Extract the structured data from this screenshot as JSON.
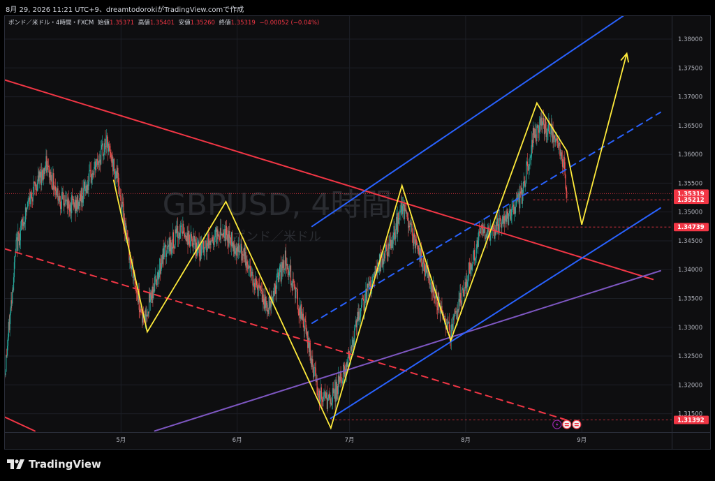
{
  "header": {
    "title": "8月 29, 2026 11:21 UTC+9、dreamtodorokiがTradingView.comで作成"
  },
  "legend": {
    "symbol": "ポンド／米ドル・4時間・FXCM",
    "open_label": "始値",
    "open": "1.35371",
    "high_label": "高値",
    "high": "1.35401",
    "low_label": "安値",
    "low": "1.35260",
    "close_label": "終値",
    "close": "1.35319",
    "change": "−0.00052 (−0.04%)"
  },
  "watermark": {
    "title": "GBPUSD, 4時間",
    "subtitle": "ポンド／米ドル"
  },
  "footer": {
    "brand": "TradingView",
    "icon": "tradingview-logo-icon"
  },
  "colors": {
    "up": "#26a69a",
    "down": "#ef5350",
    "yellow": "#ffeb3b",
    "red_line": "#f23645",
    "blue_line": "#2962ff",
    "purple_line": "#7e57c2",
    "price_tag": "#f23645"
  },
  "chart_data": {
    "type": "line",
    "title": "GBPUSD, 4時間",
    "xlabel": "",
    "ylabel": "",
    "ylim": [
      1.3118,
      1.384
    ],
    "yticks": [
      "1.38000",
      "1.37500",
      "1.37000",
      "1.36500",
      "1.36000",
      "1.35500",
      "1.35000",
      "1.34500",
      "1.34000",
      "1.33500",
      "1.33000",
      "1.32500",
      "1.32000",
      "1.31500"
    ],
    "xticks": [
      "5月",
      "6月",
      "7月",
      "8月",
      "9月"
    ],
    "price_labels": [
      {
        "value": 1.35319,
        "text": "1.35319",
        "style": "current"
      },
      {
        "value": 1.35212,
        "text": "1.35212",
        "style": "level"
      },
      {
        "value": 1.34739,
        "text": "1.34739",
        "style": "level"
      },
      {
        "value": 1.31392,
        "text": "1.31392",
        "style": "level"
      }
    ],
    "zigzag_path": [
      {
        "x": "2026-04-29",
        "y": 1.3556
      },
      {
        "x": "2026-05-08",
        "y": 1.3292
      },
      {
        "x": "2026-05-29",
        "y": 1.3518
      },
      {
        "x": "2026-06-26",
        "y": 1.3125
      },
      {
        "x": "2026-07-15",
        "y": 1.3546
      },
      {
        "x": "2026-07-28",
        "y": 1.3277
      },
      {
        "x": "2026-08-20",
        "y": 1.3689
      },
      {
        "x": "2026-08-28",
        "y": 1.3606
      },
      {
        "x": "2026-09-01",
        "y": 1.3478
      },
      {
        "x": "2026-09-13",
        "y": 1.3775
      }
    ],
    "trendlines": [
      {
        "style": "solid",
        "color": "red",
        "points": [
          {
            "x": "2026-03-31",
            "y": 1.3729
          },
          {
            "x": "2026-09-20",
            "y": 1.3383
          }
        ]
      },
      {
        "style": "solid",
        "color": "red",
        "points": [
          {
            "x": "2026-03-31",
            "y": 1.3144
          },
          {
            "x": "2026-04-08",
            "y": 1.312
          }
        ]
      },
      {
        "style": "dashed",
        "color": "red",
        "points": [
          {
            "x": "2026-03-31",
            "y": 1.3436
          },
          {
            "x": "2026-08-28",
            "y": 1.3139
          }
        ]
      },
      {
        "style": "solid",
        "color": "purple",
        "points": [
          {
            "x": "2026-05-10",
            "y": 1.312
          },
          {
            "x": "2026-09-22",
            "y": 1.3398
          }
        ]
      },
      {
        "style": "solid",
        "color": "blue",
        "points": [
          {
            "x": "2026-06-26",
            "y": 1.3142
          },
          {
            "x": "2026-09-22",
            "y": 1.3507
          }
        ]
      },
      {
        "style": "solid",
        "color": "blue",
        "points": [
          {
            "x": "2026-06-21",
            "y": 1.3475
          },
          {
            "x": "2026-09-12",
            "y": 1.384
          }
        ]
      },
      {
        "style": "dashed",
        "color": "blue",
        "points": [
          {
            "x": "2026-06-21",
            "y": 1.3307
          },
          {
            "x": "2026-09-22",
            "y": 1.3673
          }
        ]
      }
    ],
    "approx_close_path": [
      {
        "x": "2026-03-31",
        "y": 1.322
      },
      {
        "x": "2026-04-03",
        "y": 1.344
      },
      {
        "x": "2026-04-07",
        "y": 1.353
      },
      {
        "x": "2026-04-11",
        "y": 1.358
      },
      {
        "x": "2026-04-15",
        "y": 1.352
      },
      {
        "x": "2026-04-19",
        "y": 1.351
      },
      {
        "x": "2026-04-23",
        "y": 1.356
      },
      {
        "x": "2026-04-27",
        "y": 1.362
      },
      {
        "x": "2026-04-30",
        "y": 1.356
      },
      {
        "x": "2026-05-04",
        "y": 1.34
      },
      {
        "x": "2026-05-07",
        "y": 1.331
      },
      {
        "x": "2026-05-12",
        "y": 1.342
      },
      {
        "x": "2026-05-17",
        "y": 1.347
      },
      {
        "x": "2026-05-22",
        "y": 1.343
      },
      {
        "x": "2026-05-28",
        "y": 1.347
      },
      {
        "x": "2026-06-03",
        "y": 1.342
      },
      {
        "x": "2026-06-09",
        "y": 1.333
      },
      {
        "x": "2026-06-14",
        "y": 1.342
      },
      {
        "x": "2026-06-19",
        "y": 1.33
      },
      {
        "x": "2026-06-23",
        "y": 1.318
      },
      {
        "x": "2026-06-26",
        "y": 1.317
      },
      {
        "x": "2026-06-30",
        "y": 1.323
      },
      {
        "x": "2026-07-04",
        "y": 1.333
      },
      {
        "x": "2026-07-08",
        "y": 1.34
      },
      {
        "x": "2026-07-12",
        "y": 1.344
      },
      {
        "x": "2026-07-15",
        "y": 1.351
      },
      {
        "x": "2026-07-19",
        "y": 1.344
      },
      {
        "x": "2026-07-23",
        "y": 1.337
      },
      {
        "x": "2026-07-28",
        "y": 1.329
      },
      {
        "x": "2026-08-01",
        "y": 1.338
      },
      {
        "x": "2026-08-05",
        "y": 1.346
      },
      {
        "x": "2026-08-09",
        "y": 1.347
      },
      {
        "x": "2026-08-13",
        "y": 1.349
      },
      {
        "x": "2026-08-16",
        "y": 1.353
      },
      {
        "x": "2026-08-19",
        "y": 1.363
      },
      {
        "x": "2026-08-21",
        "y": 1.365
      },
      {
        "x": "2026-08-24",
        "y": 1.364
      },
      {
        "x": "2026-08-27",
        "y": 1.359
      },
      {
        "x": "2026-08-28",
        "y": 1.3532
      }
    ]
  }
}
